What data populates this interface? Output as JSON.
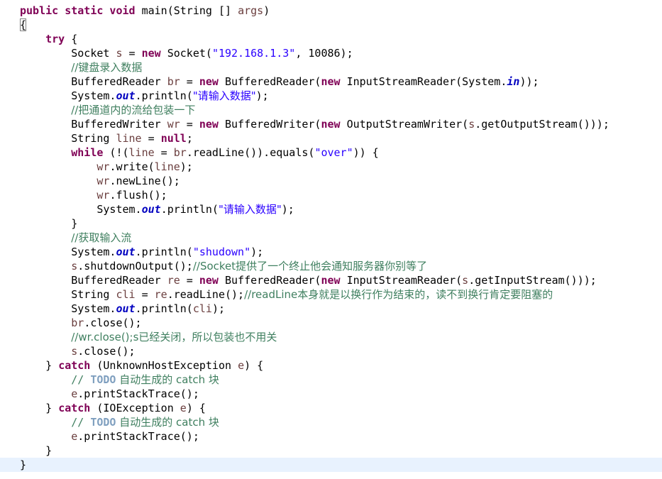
{
  "editor": {
    "language": "java",
    "colors": {
      "keyword": "#7f0055",
      "string": "#2a00ff",
      "comment": "#3f7f5f",
      "local_variable": "#6a3e3e",
      "static_field": "#0000c0",
      "todo_tag": "#7f9fbf",
      "current_line": "#e8f2fe"
    },
    "lines": [
      [
        {
          "t": "public static void",
          "c": "kw"
        },
        {
          "t": " main(String [] "
        },
        {
          "t": "args",
          "c": "var"
        },
        {
          "t": ")"
        }
      ],
      [
        {
          "t": "{",
          "c": "brace-match"
        }
      ],
      [
        {
          "t": "    "
        },
        {
          "t": "try",
          "c": "kw"
        },
        {
          "t": " {"
        }
      ],
      [
        {
          "t": "        Socket "
        },
        {
          "t": "s",
          "c": "var"
        },
        {
          "t": " = "
        },
        {
          "t": "new",
          "c": "kw"
        },
        {
          "t": " Socket("
        },
        {
          "t": "\"192.168.1.3\"",
          "c": "str"
        },
        {
          "t": ", 10086);"
        }
      ],
      [
        {
          "t": "        "
        },
        {
          "t": "//键盘录入数据",
          "c": "cmt"
        }
      ],
      [
        {
          "t": "        BufferedReader "
        },
        {
          "t": "br",
          "c": "var"
        },
        {
          "t": " = "
        },
        {
          "t": "new",
          "c": "kw"
        },
        {
          "t": " BufferedReader("
        },
        {
          "t": "new",
          "c": "kw"
        },
        {
          "t": " InputStreamReader(System."
        },
        {
          "t": "in",
          "c": "fld"
        },
        {
          "t": "));"
        }
      ],
      [
        {
          "t": "        System."
        },
        {
          "t": "out",
          "c": "fld"
        },
        {
          "t": ".println("
        },
        {
          "t": "\"请输入数据\"",
          "c": "str"
        },
        {
          "t": ");"
        }
      ],
      [
        {
          "t": "        "
        },
        {
          "t": "//把通道内的流给包装一下",
          "c": "cmt"
        }
      ],
      [
        {
          "t": "        BufferedWriter "
        },
        {
          "t": "wr",
          "c": "var"
        },
        {
          "t": " = "
        },
        {
          "t": "new",
          "c": "kw"
        },
        {
          "t": " BufferedWriter("
        },
        {
          "t": "new",
          "c": "kw"
        },
        {
          "t": " OutputStreamWriter("
        },
        {
          "t": "s",
          "c": "var"
        },
        {
          "t": ".getOutputStream()));"
        }
      ],
      [
        {
          "t": "        String "
        },
        {
          "t": "line",
          "c": "var"
        },
        {
          "t": " = "
        },
        {
          "t": "null",
          "c": "kw"
        },
        {
          "t": ";"
        }
      ],
      [
        {
          "t": "        "
        },
        {
          "t": "while",
          "c": "kw"
        },
        {
          "t": " (!("
        },
        {
          "t": "line",
          "c": "var"
        },
        {
          "t": " = "
        },
        {
          "t": "br",
          "c": "var"
        },
        {
          "t": ".readLine()).equals("
        },
        {
          "t": "\"over\"",
          "c": "str"
        },
        {
          "t": ")) {"
        }
      ],
      [
        {
          "t": "            "
        },
        {
          "t": "wr",
          "c": "var"
        },
        {
          "t": ".write("
        },
        {
          "t": "line",
          "c": "var"
        },
        {
          "t": ");"
        }
      ],
      [
        {
          "t": "            "
        },
        {
          "t": "wr",
          "c": "var"
        },
        {
          "t": ".newLine();"
        }
      ],
      [
        {
          "t": "            "
        },
        {
          "t": "wr",
          "c": "var"
        },
        {
          "t": ".flush();"
        }
      ],
      [
        {
          "t": "            System."
        },
        {
          "t": "out",
          "c": "fld"
        },
        {
          "t": ".println("
        },
        {
          "t": "\"请输入数据\"",
          "c": "str"
        },
        {
          "t": ");"
        }
      ],
      [
        {
          "t": "        }"
        }
      ],
      [
        {
          "t": "        "
        },
        {
          "t": "//获取输入流",
          "c": "cmt"
        }
      ],
      [
        {
          "t": "        System."
        },
        {
          "t": "out",
          "c": "fld"
        },
        {
          "t": ".println("
        },
        {
          "t": "\"shudown\"",
          "c": "str"
        },
        {
          "t": ");"
        }
      ],
      [
        {
          "t": "        "
        },
        {
          "t": "s",
          "c": "var"
        },
        {
          "t": ".shutdownOutput();"
        },
        {
          "t": "//Socket提供了一个终止他会通知服务器你别等了",
          "c": "cmt"
        }
      ],
      [
        {
          "t": "        BufferedReader "
        },
        {
          "t": "re",
          "c": "var"
        },
        {
          "t": " = "
        },
        {
          "t": "new",
          "c": "kw"
        },
        {
          "t": " BufferedReader("
        },
        {
          "t": "new",
          "c": "kw"
        },
        {
          "t": " InputStreamReader("
        },
        {
          "t": "s",
          "c": "var"
        },
        {
          "t": ".getInputStream()));"
        }
      ],
      [
        {
          "t": "        String "
        },
        {
          "t": "cli",
          "c": "var"
        },
        {
          "t": " = "
        },
        {
          "t": "re",
          "c": "var"
        },
        {
          "t": ".readLine();"
        },
        {
          "t": "//readLine本身就是以换行作为结束的，读不到换行肯定要阻塞的",
          "c": "cmt"
        }
      ],
      [
        {
          "t": "        System."
        },
        {
          "t": "out",
          "c": "fld"
        },
        {
          "t": ".println("
        },
        {
          "t": "cli",
          "c": "var"
        },
        {
          "t": ");"
        }
      ],
      [
        {
          "t": "        "
        },
        {
          "t": "br",
          "c": "var"
        },
        {
          "t": ".close();"
        }
      ],
      [
        {
          "t": "        "
        },
        {
          "t": "//wr.close();s已经关闭，所以包装也不用关",
          "c": "cmt"
        }
      ],
      [
        {
          "t": "        "
        },
        {
          "t": "s",
          "c": "var"
        },
        {
          "t": ".close();"
        }
      ],
      [
        {
          "t": "    } "
        },
        {
          "t": "catch",
          "c": "kw"
        },
        {
          "t": " (UnknownHostException "
        },
        {
          "t": "e",
          "c": "var"
        },
        {
          "t": ") {"
        }
      ],
      [
        {
          "t": "        "
        },
        {
          "t": "// ",
          "c": "cmt"
        },
        {
          "t": "TODO",
          "c": "todo"
        },
        {
          "t": " 自动生成的 catch 块",
          "c": "cmt"
        }
      ],
      [
        {
          "t": "        "
        },
        {
          "t": "e",
          "c": "var"
        },
        {
          "t": ".printStackTrace();"
        }
      ],
      [
        {
          "t": "    } "
        },
        {
          "t": "catch",
          "c": "kw"
        },
        {
          "t": " (IOException "
        },
        {
          "t": "e",
          "c": "var"
        },
        {
          "t": ") {"
        }
      ],
      [
        {
          "t": "        "
        },
        {
          "t": "// ",
          "c": "cmt"
        },
        {
          "t": "TODO",
          "c": "todo"
        },
        {
          "t": " 自动生成的 catch 块",
          "c": "cmt"
        }
      ],
      [
        {
          "t": "        "
        },
        {
          "t": "e",
          "c": "var"
        },
        {
          "t": ".printStackTrace();"
        }
      ],
      [
        {
          "t": "    }"
        }
      ],
      [
        {
          "t": "}"
        }
      ]
    ],
    "current_line_index": 32
  }
}
